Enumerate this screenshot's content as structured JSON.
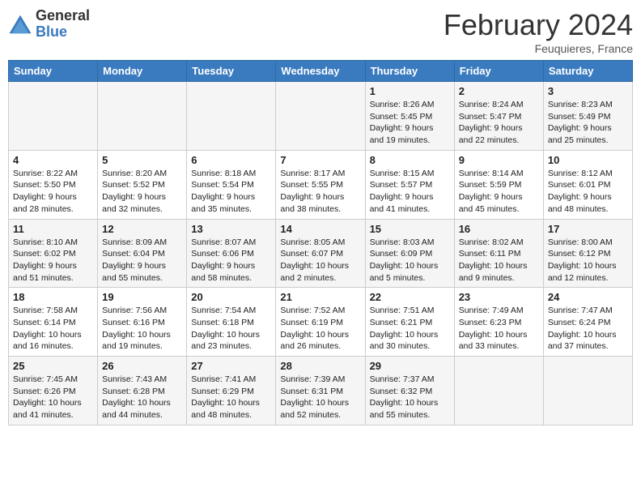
{
  "logo": {
    "general": "General",
    "blue": "Blue"
  },
  "title": "February 2024",
  "location": "Feuquieres, France",
  "days_of_week": [
    "Sunday",
    "Monday",
    "Tuesday",
    "Wednesday",
    "Thursday",
    "Friday",
    "Saturday"
  ],
  "weeks": [
    [
      {
        "day": "",
        "info": ""
      },
      {
        "day": "",
        "info": ""
      },
      {
        "day": "",
        "info": ""
      },
      {
        "day": "",
        "info": ""
      },
      {
        "day": "1",
        "info": "Sunrise: 8:26 AM\nSunset: 5:45 PM\nDaylight: 9 hours and 19 minutes."
      },
      {
        "day": "2",
        "info": "Sunrise: 8:24 AM\nSunset: 5:47 PM\nDaylight: 9 hours and 22 minutes."
      },
      {
        "day": "3",
        "info": "Sunrise: 8:23 AM\nSunset: 5:49 PM\nDaylight: 9 hours and 25 minutes."
      }
    ],
    [
      {
        "day": "4",
        "info": "Sunrise: 8:22 AM\nSunset: 5:50 PM\nDaylight: 9 hours and 28 minutes."
      },
      {
        "day": "5",
        "info": "Sunrise: 8:20 AM\nSunset: 5:52 PM\nDaylight: 9 hours and 32 minutes."
      },
      {
        "day": "6",
        "info": "Sunrise: 8:18 AM\nSunset: 5:54 PM\nDaylight: 9 hours and 35 minutes."
      },
      {
        "day": "7",
        "info": "Sunrise: 8:17 AM\nSunset: 5:55 PM\nDaylight: 9 hours and 38 minutes."
      },
      {
        "day": "8",
        "info": "Sunrise: 8:15 AM\nSunset: 5:57 PM\nDaylight: 9 hours and 41 minutes."
      },
      {
        "day": "9",
        "info": "Sunrise: 8:14 AM\nSunset: 5:59 PM\nDaylight: 9 hours and 45 minutes."
      },
      {
        "day": "10",
        "info": "Sunrise: 8:12 AM\nSunset: 6:01 PM\nDaylight: 9 hours and 48 minutes."
      }
    ],
    [
      {
        "day": "11",
        "info": "Sunrise: 8:10 AM\nSunset: 6:02 PM\nDaylight: 9 hours and 51 minutes."
      },
      {
        "day": "12",
        "info": "Sunrise: 8:09 AM\nSunset: 6:04 PM\nDaylight: 9 hours and 55 minutes."
      },
      {
        "day": "13",
        "info": "Sunrise: 8:07 AM\nSunset: 6:06 PM\nDaylight: 9 hours and 58 minutes."
      },
      {
        "day": "14",
        "info": "Sunrise: 8:05 AM\nSunset: 6:07 PM\nDaylight: 10 hours and 2 minutes."
      },
      {
        "day": "15",
        "info": "Sunrise: 8:03 AM\nSunset: 6:09 PM\nDaylight: 10 hours and 5 minutes."
      },
      {
        "day": "16",
        "info": "Sunrise: 8:02 AM\nSunset: 6:11 PM\nDaylight: 10 hours and 9 minutes."
      },
      {
        "day": "17",
        "info": "Sunrise: 8:00 AM\nSunset: 6:12 PM\nDaylight: 10 hours and 12 minutes."
      }
    ],
    [
      {
        "day": "18",
        "info": "Sunrise: 7:58 AM\nSunset: 6:14 PM\nDaylight: 10 hours and 16 minutes."
      },
      {
        "day": "19",
        "info": "Sunrise: 7:56 AM\nSunset: 6:16 PM\nDaylight: 10 hours and 19 minutes."
      },
      {
        "day": "20",
        "info": "Sunrise: 7:54 AM\nSunset: 6:18 PM\nDaylight: 10 hours and 23 minutes."
      },
      {
        "day": "21",
        "info": "Sunrise: 7:52 AM\nSunset: 6:19 PM\nDaylight: 10 hours and 26 minutes."
      },
      {
        "day": "22",
        "info": "Sunrise: 7:51 AM\nSunset: 6:21 PM\nDaylight: 10 hours and 30 minutes."
      },
      {
        "day": "23",
        "info": "Sunrise: 7:49 AM\nSunset: 6:23 PM\nDaylight: 10 hours and 33 minutes."
      },
      {
        "day": "24",
        "info": "Sunrise: 7:47 AM\nSunset: 6:24 PM\nDaylight: 10 hours and 37 minutes."
      }
    ],
    [
      {
        "day": "25",
        "info": "Sunrise: 7:45 AM\nSunset: 6:26 PM\nDaylight: 10 hours and 41 minutes."
      },
      {
        "day": "26",
        "info": "Sunrise: 7:43 AM\nSunset: 6:28 PM\nDaylight: 10 hours and 44 minutes."
      },
      {
        "day": "27",
        "info": "Sunrise: 7:41 AM\nSunset: 6:29 PM\nDaylight: 10 hours and 48 minutes."
      },
      {
        "day": "28",
        "info": "Sunrise: 7:39 AM\nSunset: 6:31 PM\nDaylight: 10 hours and 52 minutes."
      },
      {
        "day": "29",
        "info": "Sunrise: 7:37 AM\nSunset: 6:32 PM\nDaylight: 10 hours and 55 minutes."
      },
      {
        "day": "",
        "info": ""
      },
      {
        "day": "",
        "info": ""
      }
    ]
  ]
}
